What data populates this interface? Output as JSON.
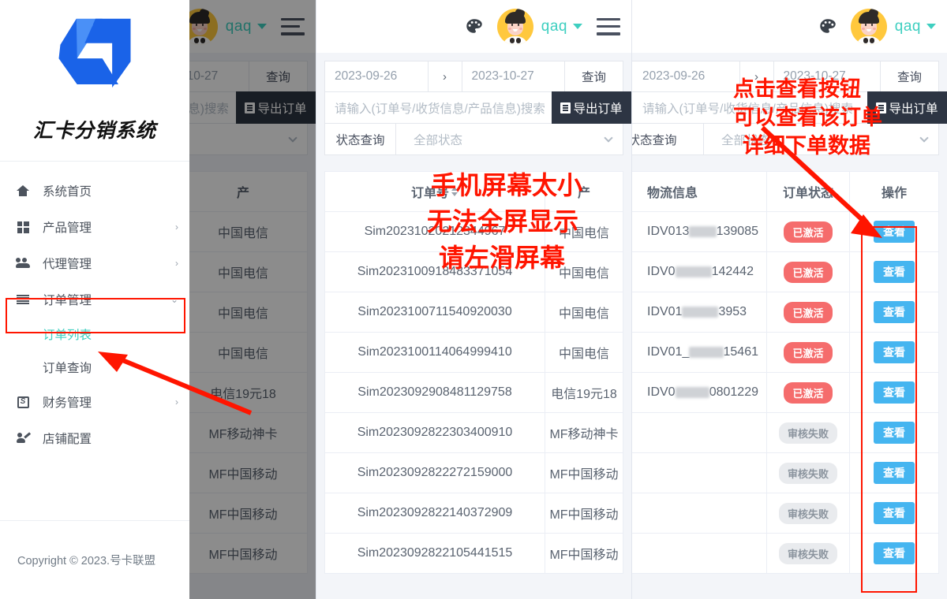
{
  "app": {
    "brand_name": "汇卡分销系统",
    "user_name": "qaq",
    "copyright": "Copyright © 2023.号卡联盟",
    "accent_teal": "#3ecfc0",
    "logo_blue": "#1a63e8",
    "logo_blue_light": "#4a90f7",
    "annotation_red": "#ff1500",
    "view_button_blue": "#45b5f0",
    "badge_active_red": "#f56c6c"
  },
  "navbar": {
    "palette_icon": "palette-icon",
    "avatar_icon": "user-avatar",
    "user_label": "qaq",
    "caret_icon": "caret-down-icon",
    "menu_icon": "hamburger-menu-icon"
  },
  "sidebar": {
    "logo_icon": "brand-logo-icon",
    "title": "汇卡分销系统",
    "items": [
      {
        "label": "系统首页",
        "icon": "home-icon",
        "arrow": "",
        "has_arrow": false
      },
      {
        "label": "产品管理",
        "icon": "grid-icon",
        "arrow": "›",
        "has_arrow": true
      },
      {
        "label": "代理管理",
        "icon": "users-icon",
        "arrow": "›",
        "has_arrow": true
      },
      {
        "label": "订单管理",
        "icon": "list-lines-icon",
        "arrow": "⌄",
        "has_arrow": true,
        "highlighted": true
      },
      {
        "label": "财务管理",
        "icon": "money-icon",
        "arrow": "›",
        "has_arrow": true
      },
      {
        "label": "店铺配置",
        "icon": "pen-user-icon",
        "arrow": "",
        "has_arrow": false
      }
    ],
    "sub_items": [
      {
        "label": "订单列表",
        "active": true
      },
      {
        "label": "订单查询",
        "active": false
      }
    ],
    "footer": "Copyright © 2023.号卡联盟"
  },
  "filters": {
    "date_start": "2023-09-26",
    "date_separator": "›",
    "date_end": "2023-10-27",
    "query_button": "查询",
    "search_placeholder": "请输入(订单号/收货信息/产品信息)搜索",
    "search_value": "",
    "status_label": "状态查询",
    "status_selected": "全部状态",
    "status_caret": "chevron-down-icon",
    "export_button": "导出订单",
    "export_icon": "export-file-icon"
  },
  "table": {
    "headers": {
      "order_no": "订单号",
      "product": "产品信息",
      "product_short": "产",
      "logistics": "物流信息",
      "status": "订单状态",
      "action": "操作"
    },
    "sort_icon": "sort-updown-icon",
    "rows": [
      {
        "order_no": "Sim20231020212344967",
        "order_tail": "67",
        "product": "中国电信",
        "logistics": "IDV013",
        "logistics_tail": "139085",
        "status": "已激活",
        "status_type": "active",
        "action": "查看"
      },
      {
        "order_no": "Sim2023100918483371054",
        "order_tail": "54",
        "product": "中国电信",
        "logistics": "IDV0",
        "logistics_tail": "142442",
        "status": "已激活",
        "status_type": "active",
        "action": "查看"
      },
      {
        "order_no": "Sim2023100711540920030",
        "order_tail": "30",
        "product": "中国电信",
        "logistics": "IDV01",
        "logistics_tail": "3953",
        "status": "已激活",
        "status_type": "active",
        "action": "查看"
      },
      {
        "order_no": "Sim2023100114064999410",
        "order_tail": "10",
        "product": "中国电信",
        "logistics": "IDV01_",
        "logistics_tail": "15461",
        "status": "已激活",
        "status_type": "active",
        "action": "查看"
      },
      {
        "order_no": "Sim2023092908481129758",
        "order_tail": "58",
        "product": "电信19元18",
        "logistics": "IDV0",
        "logistics_tail": "0801229",
        "status": "已激活",
        "status_type": "active",
        "action": "查看"
      },
      {
        "order_no": "Sim2023092822303400910",
        "order_tail": "10",
        "product": "MF移动神卡",
        "logistics": "",
        "logistics_tail": "",
        "status": "审核失败",
        "status_type": "failed",
        "action": "查看"
      },
      {
        "order_no": "Sim2023092822272159000",
        "order_tail": "00",
        "product": "MF中国移动",
        "logistics": "",
        "logistics_tail": "",
        "status": "审核失败",
        "status_type": "failed",
        "action": "查看"
      },
      {
        "order_no": "Sim2023092822140372909",
        "order_tail": "09",
        "product": "MF中国移动",
        "logistics": "",
        "logistics_tail": "",
        "status": "审核失败",
        "status_type": "failed",
        "action": "查看"
      },
      {
        "order_no": "Sim2023092822105441515",
        "order_tail": "15",
        "product": "MF中国移动",
        "logistics": "",
        "logistics_tail": "",
        "status": "审核失败",
        "status_type": "failed",
        "action": "查看"
      }
    ]
  },
  "annotations": {
    "middle": {
      "line1": "手机屏幕太小",
      "line2": "无法全屏显示",
      "line3": "请左滑屏幕"
    },
    "right": {
      "line1": "点击查看按钮",
      "line2": "可以查看该订单",
      "line3": "详细下单数据"
    },
    "arrow_to_order_list": "red-arrow-icon",
    "arrow_to_view_button": "red-arrow-icon",
    "box_order_menu": "red-highlight-box",
    "box_action_column": "red-highlight-box"
  }
}
